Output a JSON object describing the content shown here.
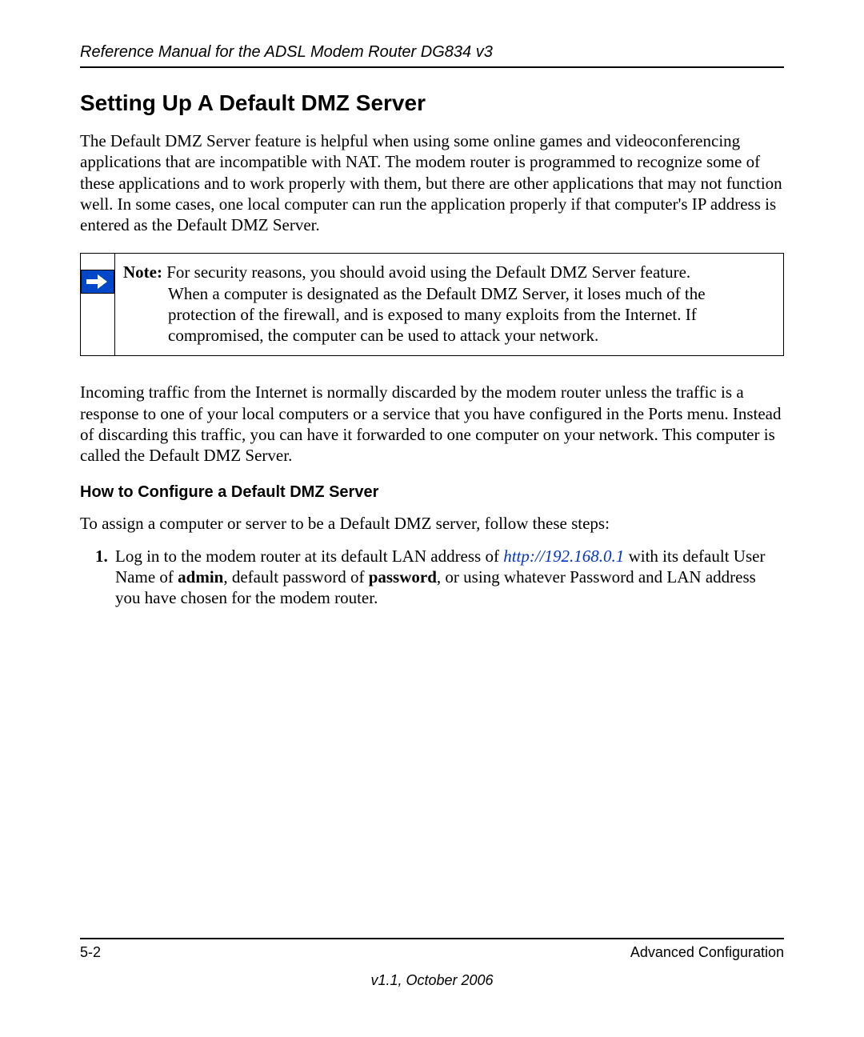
{
  "header": {
    "running_head": "Reference Manual for the ADSL Modem Router DG834 v3"
  },
  "section": {
    "title": "Setting Up A Default DMZ Server",
    "intro": "The Default DMZ Server feature is helpful when using some online games and videoconferencing applications that are incompatible with NAT. The modem router is programmed to recognize some of these applications and to work properly with them, but there are other applications that may not function well. In some cases, one local computer can run the application properly if that computer's IP address is entered as the Default DMZ Server."
  },
  "note": {
    "label": "Note:",
    "text_first": " For security reasons, you should avoid using the Default DMZ Server feature.",
    "text_rest": "When a computer is designated as the Default DMZ Server, it loses much of the protection of the firewall, and is exposed to many exploits from the Internet. If compromised, the computer can be used to attack your network."
  },
  "para2": "Incoming traffic from the Internet is normally discarded by the modem router unless the traffic is a response to one of your local computers or a service that you have configured in the Ports menu. Instead of discarding this traffic, you can have it forwarded to one computer on your network. This computer is called the Default DMZ Server.",
  "subsection": {
    "title": "How to Configure a Default DMZ Server",
    "lead": "To assign a computer or server to be a Default DMZ server, follow these steps:"
  },
  "step1": {
    "pre": "Log in to the modem router at its default LAN address of ",
    "link": "http://192.168.0.1",
    "mid1": " with its default User Name of ",
    "bold1": "admin",
    "mid2": ", default password of ",
    "bold2": "password",
    "post": ", or using whatever Password and LAN address you have chosen for the modem router."
  },
  "footer": {
    "page": "5-2",
    "section": "Advanced Configuration",
    "version": "v1.1, October 2006"
  }
}
